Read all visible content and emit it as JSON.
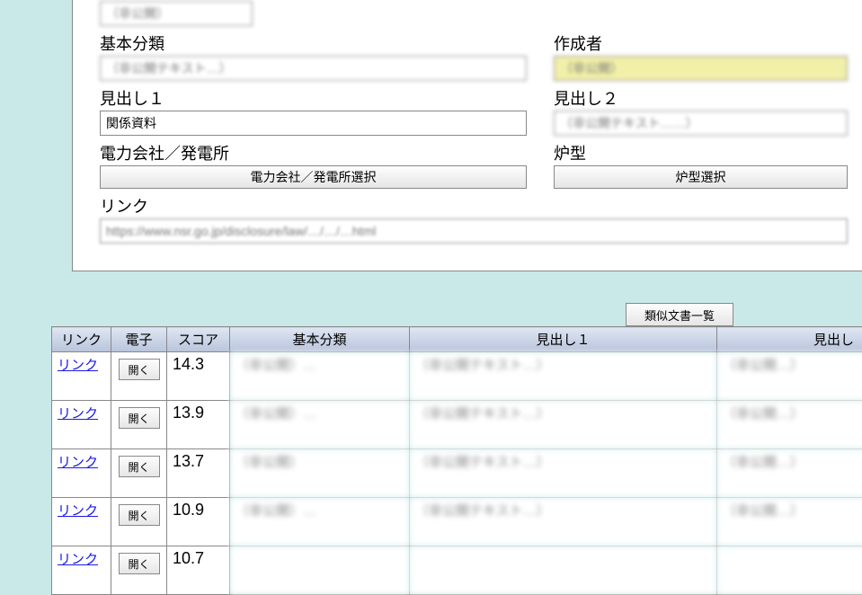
{
  "form": {
    "topSmallLabel": "",
    "topSmallValue": "（非公開）",
    "basicCategory": {
      "label": "基本分類",
      "value": "（非公開テキスト…）"
    },
    "author": {
      "label": "作成者",
      "value": "（非公開）"
    },
    "heading1": {
      "label": "見出し１",
      "value": "関係資料"
    },
    "heading2": {
      "label": "見出し２",
      "value": "（非公開テキスト……）"
    },
    "powerCompany": {
      "label": "電力会社／発電所",
      "button": "電力会社／発電所選択"
    },
    "reactorType": {
      "label": "炉型",
      "button": "炉型選択"
    },
    "linkField": {
      "label": "リンク",
      "value": "https://www.nsr.go.jp/disclosure/law/…/…/…html"
    },
    "tabButton": "類似文書一覧"
  },
  "table": {
    "headers": {
      "link": "リンク",
      "denshi": "電子",
      "score": "スコア",
      "category": "基本分類",
      "heading1": "見出し１",
      "heading2": "見出し"
    },
    "linkText": "リンク",
    "openText": "開く",
    "rows": [
      {
        "score": "14.3",
        "cat": "（非公開）…",
        "h1": "（非公開テキスト…）",
        "h2": "（非公開…）"
      },
      {
        "score": "13.9",
        "cat": "（非公開）…",
        "h1": "（非公開テキスト…）",
        "h2": "（非公開…）"
      },
      {
        "score": "13.7",
        "cat": "（非公開）",
        "h1": "（非公開テキスト…）",
        "h2": "（非公開…）"
      },
      {
        "score": "10.9",
        "cat": "（非公開）…",
        "h1": "（非公開テキスト…）",
        "h2": "（非公開…）"
      },
      {
        "score": "10.7",
        "cat": "",
        "h1": "",
        "h2": ""
      }
    ]
  }
}
